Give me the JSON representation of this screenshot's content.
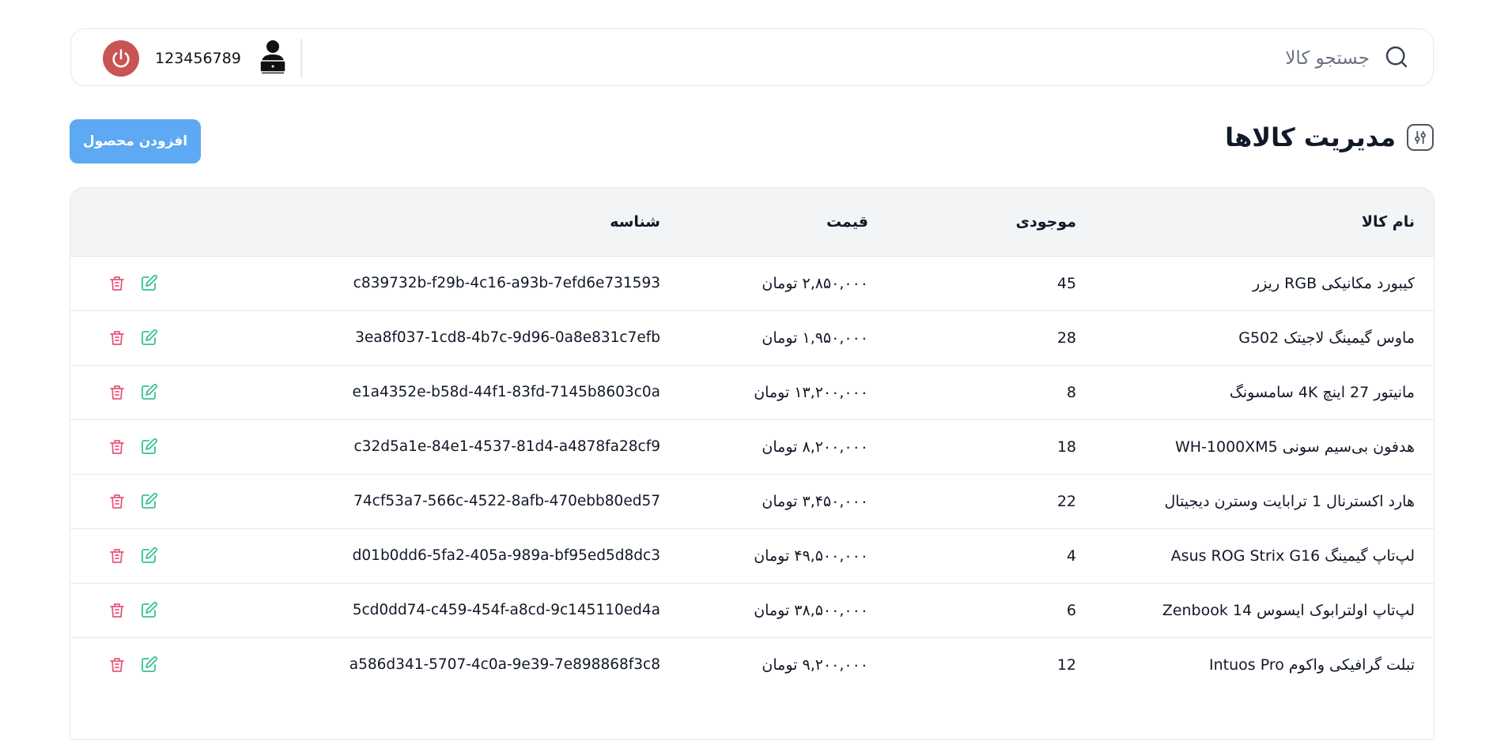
{
  "header": {
    "search_placeholder": "جستجو کالا",
    "user_phone": "123456789"
  },
  "page": {
    "title": "مدیریت کالاها",
    "add_button": "افزودن محصول"
  },
  "table": {
    "columns": {
      "name": "نام کالا",
      "stock": "موجودی",
      "price": "قیمت",
      "id": "شناسه"
    },
    "rows": [
      {
        "name": "کیبورد مکانیکی RGB ریزر",
        "stock": "45",
        "price": "۲,۸۵۰,۰۰۰ تومان",
        "id": "c839732b-f29b-4c16-a93b-7efd6e731593"
      },
      {
        "name": "ماوس گیمینگ لاجیتک G502",
        "stock": "28",
        "price": "۱,۹۵۰,۰۰۰ تومان",
        "id": "3ea8f037-1cd8-4b7c-9d96-0a8e831c7efb"
      },
      {
        "name": "مانیتور 27 اینچ 4K سامسونگ",
        "stock": "8",
        "price": "۱۳,۲۰۰,۰۰۰ تومان",
        "id": "e1a4352e-b58d-44f1-83fd-7145b8603c0a"
      },
      {
        "name": "هدفون بی‌سیم سونی WH-1000XM5",
        "stock": "18",
        "price": "۸,۲۰۰,۰۰۰ تومان",
        "id": "c32d5a1e-84e1-4537-81d4-a4878fa28cf9"
      },
      {
        "name": "هارد اکسترنال 1 ترابایت وسترن دیجیتال",
        "stock": "22",
        "price": "۳,۴۵۰,۰۰۰ تومان",
        "id": "74cf53a7-566c-4522-8afb-470ebb80ed57"
      },
      {
        "name": "لپ‌تاپ گیمینگ Asus ROG Strix G16",
        "stock": "4",
        "price": "۴۹,۵۰۰,۰۰۰ تومان",
        "id": "d01b0dd6-5fa2-405a-989a-bf95ed5d8dc3"
      },
      {
        "name": "لپ‌تاپ اولترابوک ایسوس Zenbook 14",
        "stock": "6",
        "price": "۳۸,۵۰۰,۰۰۰ تومان",
        "id": "5cd0dd74-c459-454f-a8cd-9c145110ed4a"
      },
      {
        "name": "تبلت گرافیکی واکوم Intuos Pro",
        "stock": "12",
        "price": "۹,۲۰۰,۰۰۰ تومان",
        "id": "a586d341-5707-4c0a-9e39-7e898868f3c8"
      }
    ]
  },
  "colors": {
    "primary_button": "#5da9f3",
    "power_button": "#c95454",
    "edit_icon": "#34c38f",
    "delete_icon": "#e8577a",
    "table_header_bg": "#f3f4f6"
  },
  "icons": {
    "search": "search-icon",
    "power": "power-icon",
    "avatar": "user-laptop-icon",
    "title": "sliders-icon",
    "edit": "edit-icon",
    "delete": "trash-icon"
  }
}
